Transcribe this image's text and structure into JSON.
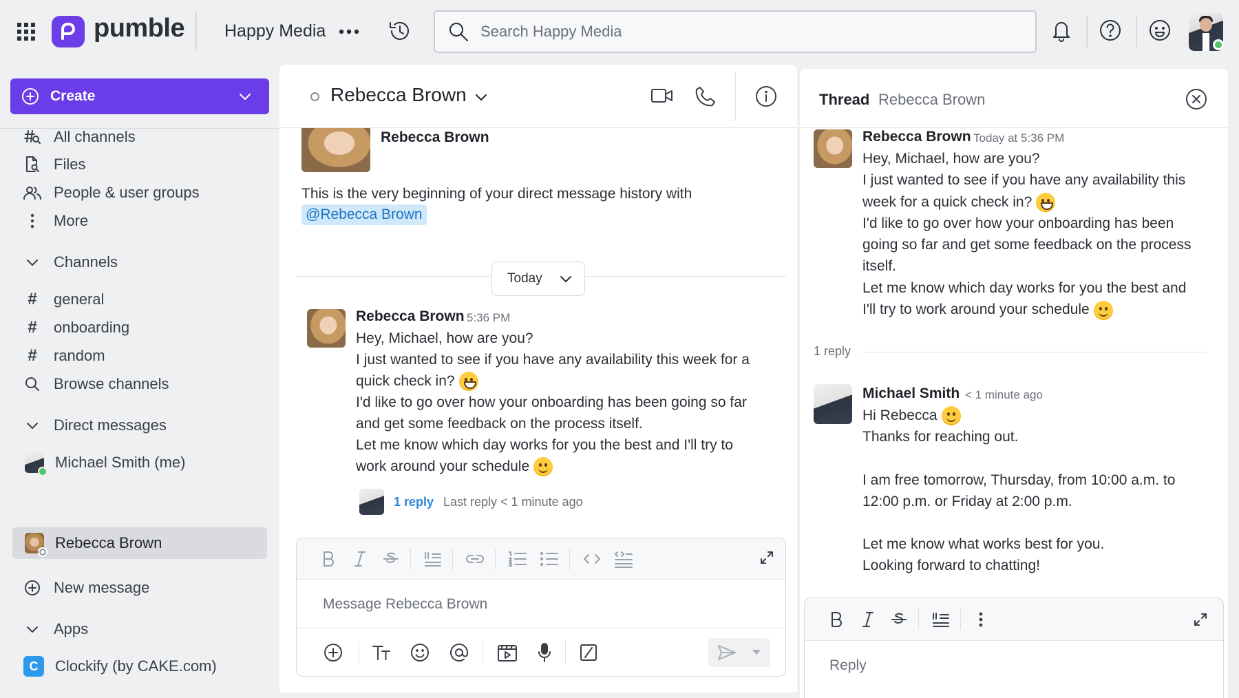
{
  "topbar": {
    "brand": "pumble",
    "workspace": "Happy Media",
    "search_placeholder": "Search Happy Media"
  },
  "sidebar": {
    "create_label": "Create",
    "nav": [
      {
        "label": "All channels",
        "icon": "hash-search-icon"
      },
      {
        "label": "Files",
        "icon": "file-search-icon"
      },
      {
        "label": "People & user groups",
        "icon": "people-icon"
      },
      {
        "label": "More",
        "icon": "more-vertical-icon"
      }
    ],
    "channels_header": "Channels",
    "channels": [
      "general",
      "onboarding",
      "random"
    ],
    "browse_channels": "Browse channels",
    "dm_header": "Direct messages",
    "dms": [
      "Michael Smith (me)",
      "Rebecca Brown"
    ],
    "new_message": "New message",
    "apps_header": "Apps",
    "apps": [
      "Clockify (by CAKE.com)"
    ]
  },
  "channel": {
    "name": "Rebecca Brown",
    "intro_name": "Rebecca Brown",
    "intro_text": "This is the very beginning of your direct message history with",
    "mention": "@Rebecca Brown",
    "date_label": "Today",
    "message": {
      "author": "Rebecca Brown",
      "time": "5:36 PM",
      "line1": "Hey, Michael, how are you?",
      "line2": "I just wanted to see if you have any availability this week for a",
      "line3": "quick check in?",
      "line4": "I'd like to go over how your onboarding has been going so far",
      "line5": "and get some feedback on the process itself.",
      "line6": "Let me know which day works for you the best and I'll try to",
      "line7": "work around your schedule"
    },
    "reply_count": "1 reply",
    "last_reply": "Last reply < 1 minute ago",
    "composer_placeholder": "Message Rebecca Brown"
  },
  "thread": {
    "title": "Thread",
    "subtitle": "Rebecca Brown",
    "parent": {
      "author": "Rebecca Brown",
      "time": "Today at 5:36 PM",
      "line1": "Hey, Michael, how are you?",
      "line2": "I just wanted to see if you have any availability this",
      "line3": "week for a quick check in?",
      "line4": "I'd like to go over how your onboarding has been",
      "line5": "going so far and get some feedback on the process",
      "line6": "itself.",
      "line7": "Let me know which day works for you the best and",
      "line8": "I'll try to work around your schedule"
    },
    "reply_count": "1 reply",
    "reply": {
      "author": "Michael Smith",
      "time": "< 1 minute ago",
      "line1": "Hi Rebecca",
      "line2": "Thanks for reaching out.",
      "line3": "I am free tomorrow, Thursday, from 10:00 a.m. to",
      "line4": "12:00 p.m. or Friday at 2:00 p.m.",
      "line5": "Let me know what works best for you.",
      "line6": "Looking forward to chatting!"
    },
    "composer_placeholder": "Reply"
  },
  "colors": {
    "accent": "#6a3de8",
    "link": "#2f86d8",
    "mention_bg": "#cfe9fb",
    "online": "#52c56a"
  }
}
